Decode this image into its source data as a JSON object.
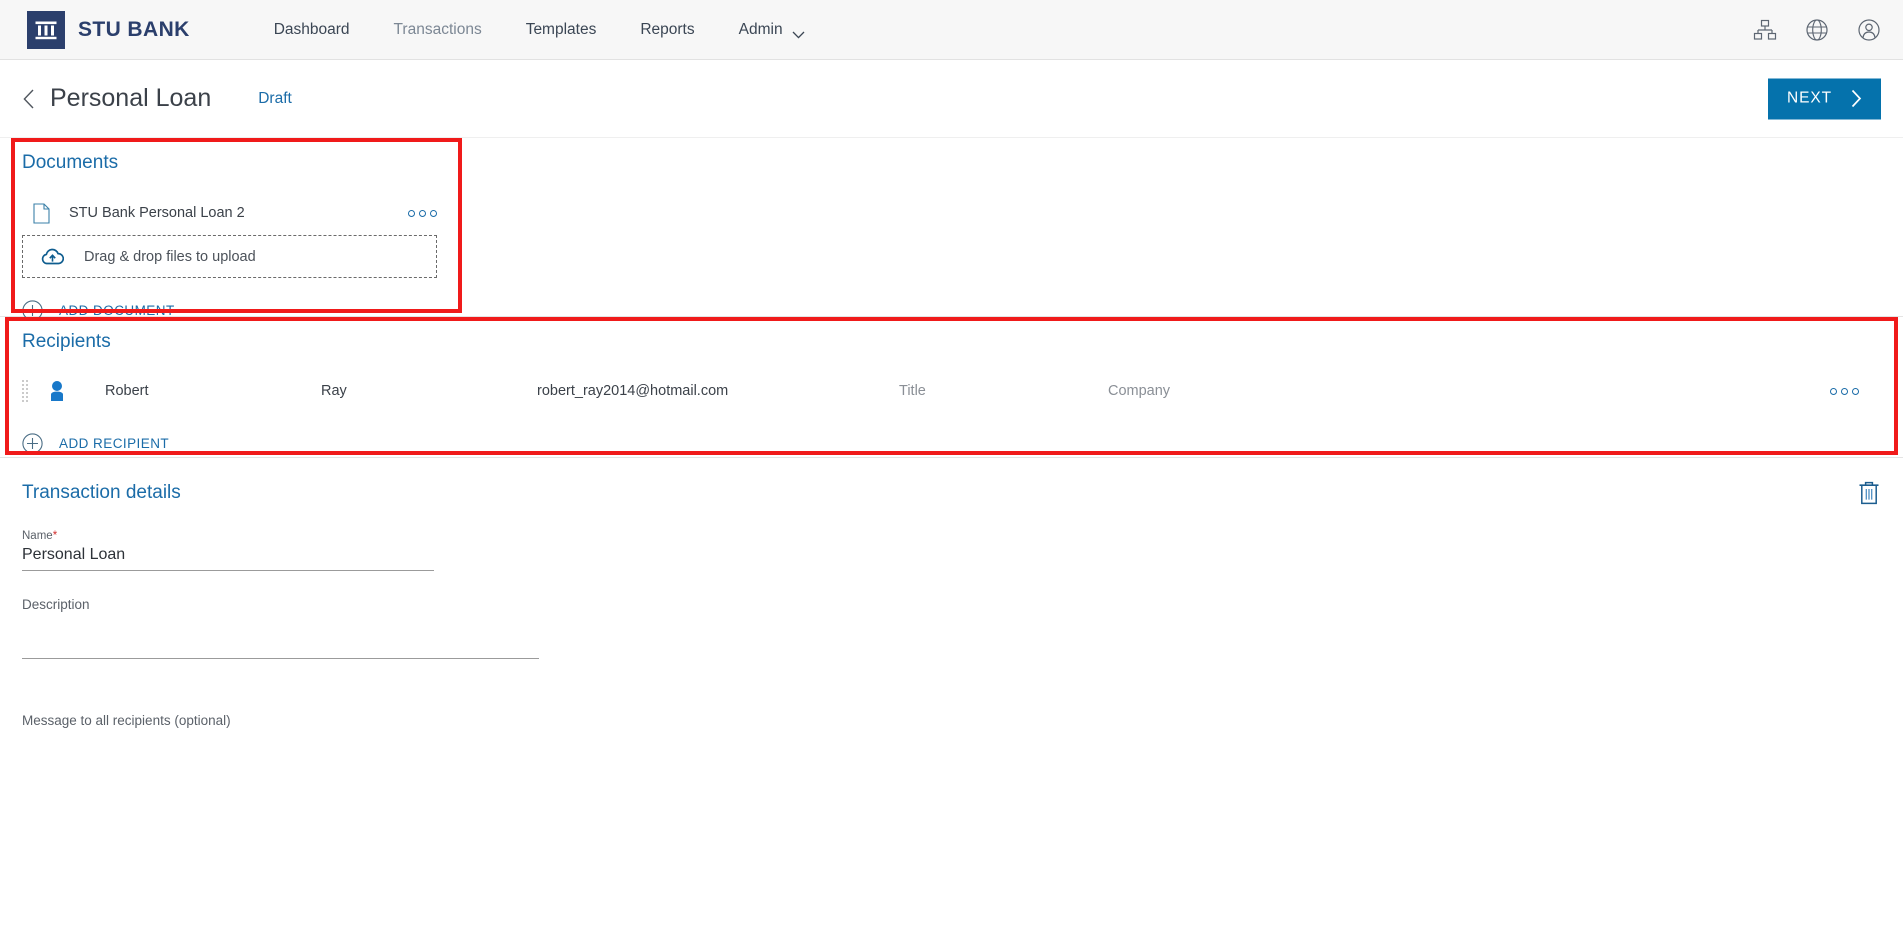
{
  "brand": {
    "name": "STU BANK",
    "logo_icon": "bank-columns-icon",
    "logo_bg": "#2b3f6c"
  },
  "nav": {
    "items": [
      {
        "label": "Dashboard",
        "muted": false,
        "has_caret": false
      },
      {
        "label": "Transactions",
        "muted": true,
        "has_caret": false
      },
      {
        "label": "Templates",
        "muted": false,
        "has_caret": false
      },
      {
        "label": "Reports",
        "muted": false,
        "has_caret": false
      },
      {
        "label": "Admin",
        "muted": false,
        "has_caret": true
      }
    ],
    "right_icons": [
      "sitemap-icon",
      "globe-icon",
      "user-account-icon"
    ]
  },
  "page_header": {
    "back_icon": "chevron-left-icon",
    "title": "Personal Loan",
    "status": "Draft",
    "status_color": "#1b6ca8",
    "next_label": "NEXT",
    "next_icon": "chevron-right-icon",
    "next_color": "#0572ac"
  },
  "documents": {
    "title": "Documents",
    "highlighted": true,
    "highlight_color": "#f01a1a",
    "items": [
      {
        "name": "STU Bank Personal Loan 2",
        "file_icon": "document-file-icon",
        "menu_icon": "overflow-menu-icon"
      }
    ],
    "dropzone": {
      "text": "Drag & drop files to upload",
      "icon": "cloud-upload-icon"
    },
    "add_label": "ADD DOCUMENT",
    "add_icon": "plus-circle-icon"
  },
  "recipients": {
    "title": "Recipients",
    "highlighted": true,
    "highlight_color": "#f01a1a",
    "rows": [
      {
        "drag_icon": "drag-handle-icon",
        "avatar_icon": "person-avatar-icon",
        "first_name": "Robert",
        "last_name": "Ray",
        "email": "robert_ray2014@hotmail.com",
        "title_placeholder": "Title",
        "company_placeholder": "Company",
        "menu_icon": "overflow-menu-icon"
      }
    ],
    "add_label": "ADD RECIPIENT",
    "add_icon": "plus-circle-icon"
  },
  "transaction_details": {
    "title": "Transaction details",
    "delete_icon": "trash-icon",
    "name_label": "Name",
    "name_required_mark": "*",
    "name_value": "Personal Loan",
    "description_label": "Description",
    "description_value": "",
    "message_label": "Message to all recipients (optional)"
  }
}
